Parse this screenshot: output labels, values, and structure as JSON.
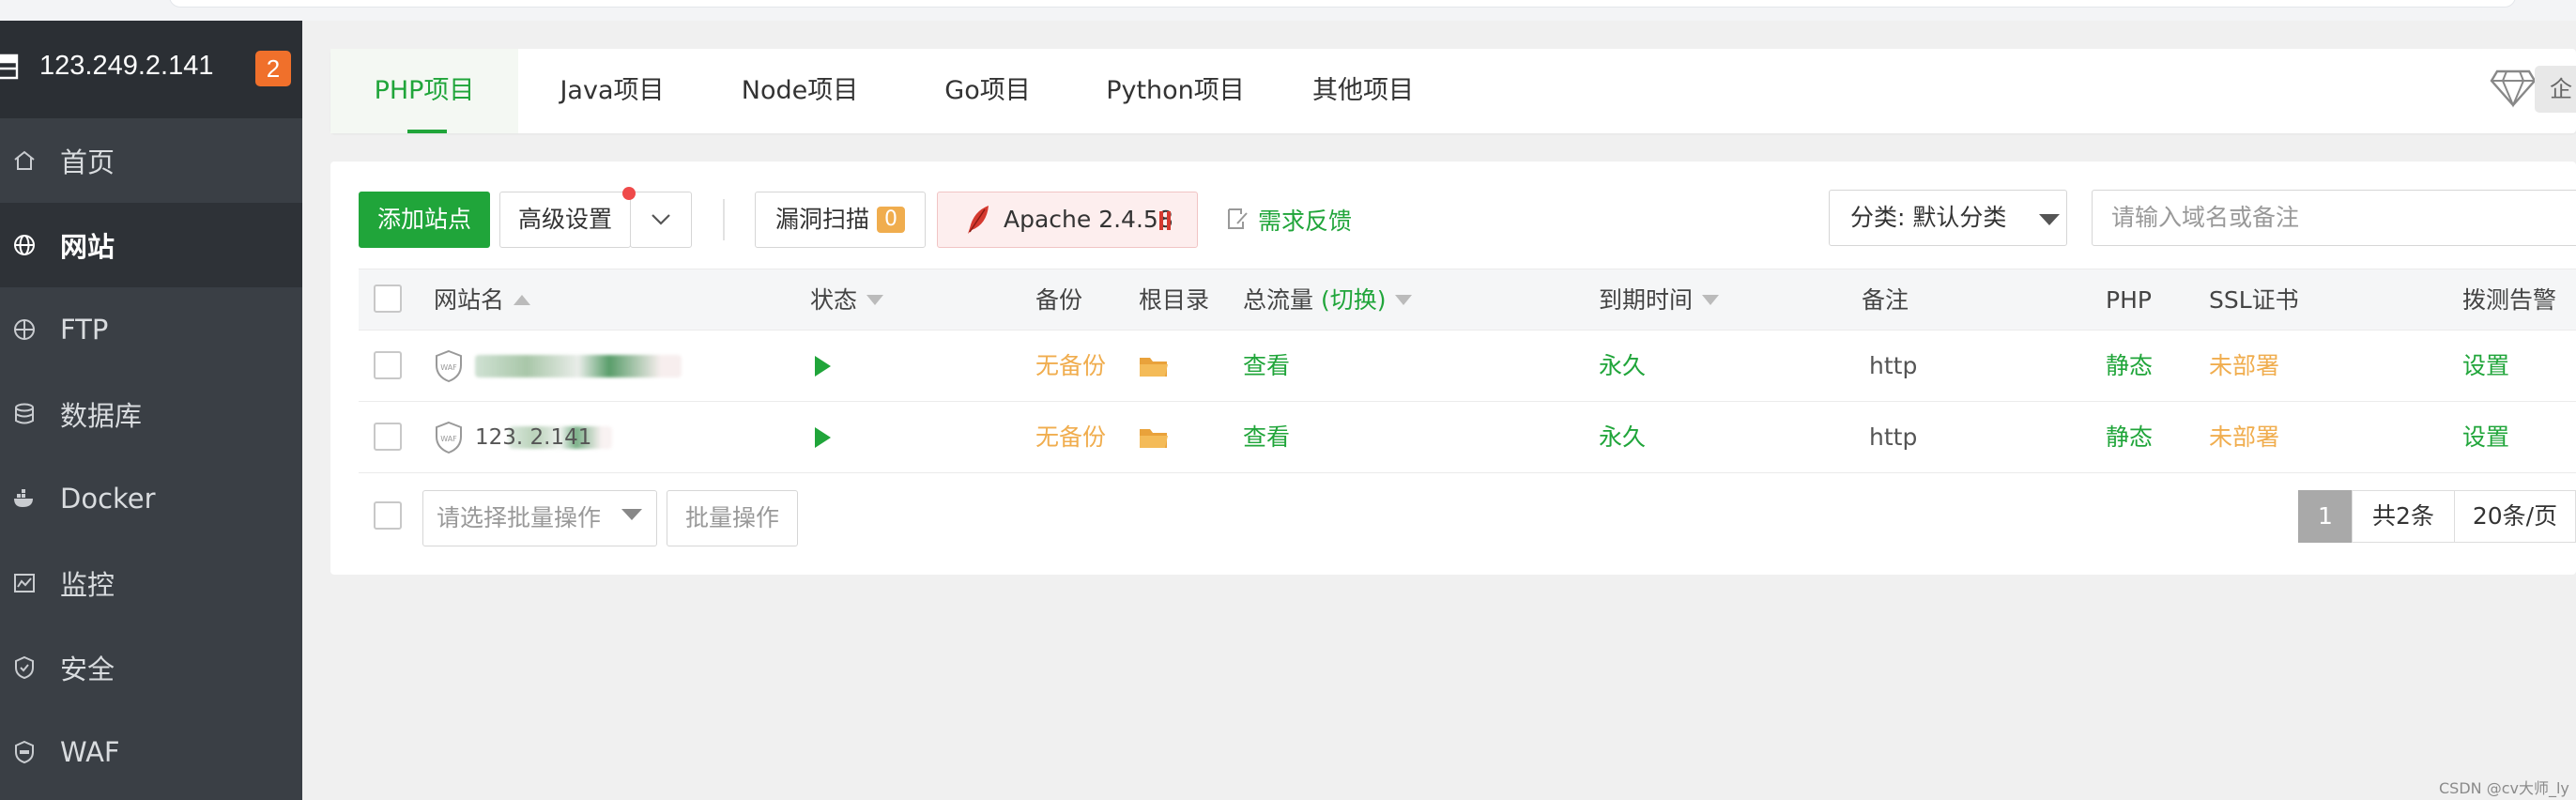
{
  "sidebar": {
    "host": "123.249.2.141",
    "badge": "2",
    "items": [
      {
        "label": "首页",
        "icon": "home-icon"
      },
      {
        "label": "网站",
        "icon": "globe-icon"
      },
      {
        "label": "FTP",
        "icon": "ftp-icon"
      },
      {
        "label": "数据库",
        "icon": "database-icon"
      },
      {
        "label": "Docker",
        "icon": "docker-icon"
      },
      {
        "label": "监控",
        "icon": "monitor-icon"
      },
      {
        "label": "安全",
        "icon": "shield-icon"
      },
      {
        "label": "WAF",
        "icon": "waf-icon"
      }
    ],
    "active_index": 1
  },
  "tabs": [
    "PHP项目",
    "Java项目",
    "Node项目",
    "Go项目",
    "Python项目",
    "其他项目"
  ],
  "active_tab": "PHP项目",
  "vip_label": "企",
  "toolbar": {
    "add_site": "添加站点",
    "advanced": "高级设置",
    "vuln_scan": "漏洞扫描",
    "vuln_count": "0",
    "apache": "Apache 2.4.58",
    "feedback": "需求反馈",
    "category": "分类: 默认分类",
    "search_placeholder": "请输入域名或备注"
  },
  "table": {
    "headers": {
      "name": "网站名",
      "status": "状态",
      "backup": "备份",
      "root": "根目录",
      "traffic": "总流量",
      "traffic_switch": "(切换)",
      "expire": "到期时间",
      "note": "备注",
      "php": "PHP",
      "ssl": "SSL证书",
      "alert": "拨测告警"
    },
    "rows": [
      {
        "name_visible": "",
        "backup": "无备份",
        "traffic": "查看",
        "expire": "永久",
        "note": "http",
        "php": "静态",
        "ssl": "未部署",
        "alert": "设置"
      },
      {
        "name_visible": "123.    2.141",
        "backup": "无备份",
        "traffic": "查看",
        "expire": "永久",
        "note": "http",
        "php": "静态",
        "ssl": "未部署",
        "alert": "设置"
      }
    ]
  },
  "batch": {
    "select_placeholder": "请选择批量操作",
    "action": "批量操作"
  },
  "pagination": {
    "current": "1",
    "total": "共2条",
    "per_page": "20条/页"
  },
  "watermark": "CSDN @cv大师_ly",
  "colors": {
    "accent": "#20a53a",
    "warning": "#f0ad4e",
    "sidebar_bg": "#3a3f45",
    "badge": "#f0702b"
  }
}
